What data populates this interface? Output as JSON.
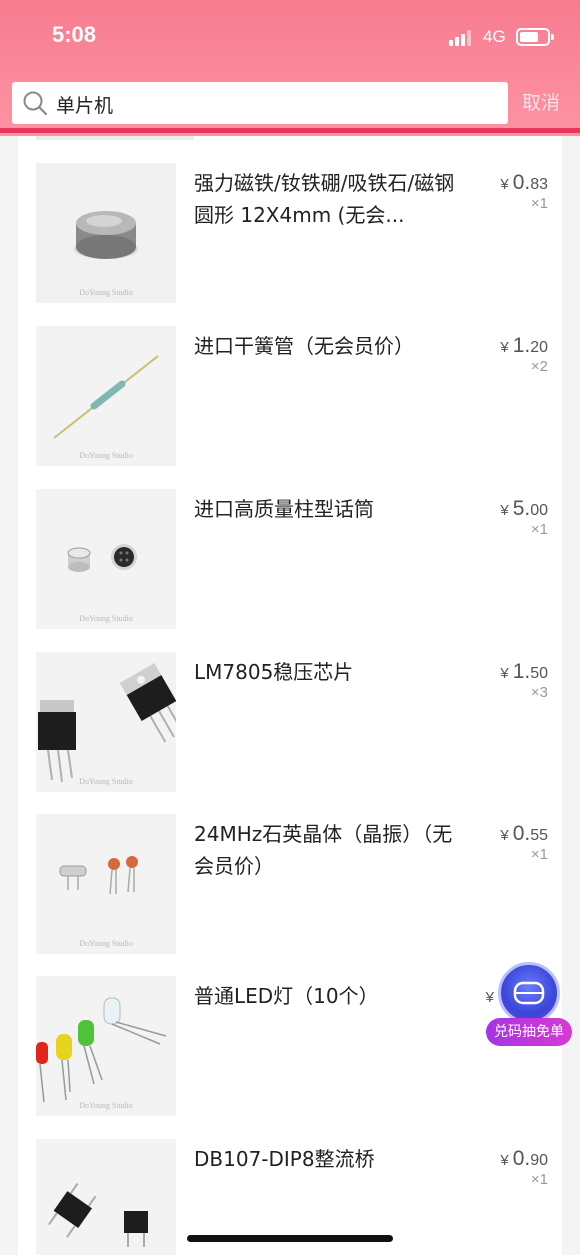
{
  "status_bar": {
    "time": "5:08",
    "network": "4G"
  },
  "search": {
    "query": "单片机",
    "cancel_label": "取消"
  },
  "items": [
    {
      "title": "强力磁铁/钕铁硼/吸铁石/磁钢 圆形 12X4mm (无会...",
      "currency": "¥",
      "price_int": "0.",
      "price_dec": "83",
      "qty": "×1",
      "watermark": "DoYoung Studio",
      "image": "magnet"
    },
    {
      "title": "进口干簧管（无会员价）",
      "currency": "¥",
      "price_int": "1.",
      "price_dec": "20",
      "qty": "×2",
      "watermark": "DoYoung Studio",
      "image": "reed-switch"
    },
    {
      "title": "进口高质量柱型话筒",
      "currency": "¥",
      "price_int": "5.",
      "price_dec": "00",
      "qty": "×1",
      "watermark": "DoYoung Studio",
      "image": "microphone"
    },
    {
      "title": "LM7805稳压芯片",
      "currency": "¥",
      "price_int": "1.",
      "price_dec": "50",
      "qty": "×3",
      "watermark": "DoYoung Studio",
      "image": "regulator"
    },
    {
      "title": "24MHz石英晶体（晶振）（无会员价）",
      "currency": "¥",
      "price_int": "0.",
      "price_dec": "55",
      "qty": "×1",
      "watermark": "DoYoung Studio",
      "image": "crystal"
    },
    {
      "title": "普通LED灯（10个）",
      "currency": "¥",
      "price_int": "",
      "price_dec": "",
      "qty": "",
      "watermark": "DoYoung Studio",
      "image": "led"
    },
    {
      "title": "DB107-DIP8整流桥",
      "currency": "¥",
      "price_int": "0.",
      "price_dec": "90",
      "qty": "×1",
      "watermark": "",
      "image": "bridge"
    }
  ],
  "promo": {
    "label": "兑码抽免单"
  },
  "colors": {
    "header_top": "#f77b8f",
    "accent_line": "#e8365d",
    "promo": "#a734e6"
  }
}
